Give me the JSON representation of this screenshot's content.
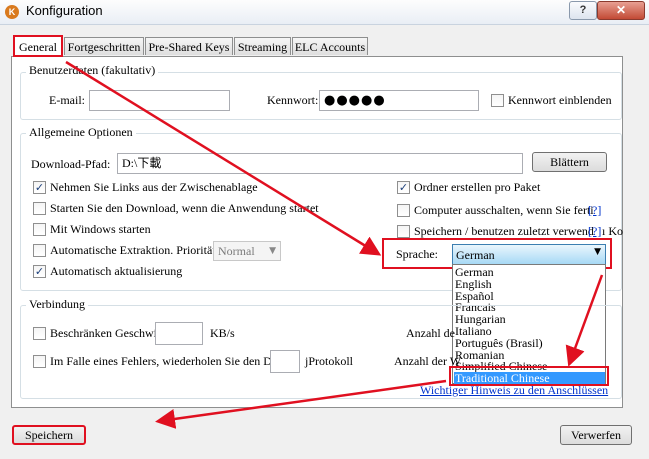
{
  "window": {
    "title": "Konfiguration",
    "icon_letter": "K",
    "help_label": "?",
    "close_label": "✕"
  },
  "tabs": [
    "General",
    "Fortgeschritten",
    "Pre-Shared Keys",
    "Streaming",
    "ELC Accounts"
  ],
  "user_data": {
    "legend": "Benutzerdaten (fakultativ)",
    "email_label": "E-mail:",
    "email_value": "",
    "password_label": "Kennwort:",
    "password_value": "●●●●●",
    "show_password_label": "Kennwort einblenden"
  },
  "general": {
    "legend": "Allgemeine Optionen",
    "download_path_label": "Download-Pfad:",
    "download_path_value": "D:\\下載",
    "browse_label": "Blättern",
    "options_left": [
      {
        "label": "Nehmen Sie Links aus der Zwischenablage",
        "checked": true
      },
      {
        "label": "Starten Sie den Download, wenn die Anwendung startet",
        "checked": false
      },
      {
        "label": "Mit Windows starten",
        "checked": false
      },
      {
        "label": "Automatische Extraktion. Priorität:",
        "checked": false
      },
      {
        "label": "Automatisch aktualisierung",
        "checked": true
      }
    ],
    "priority_value": "Normal",
    "options_right": [
      {
        "label": "Ordner erstellen pro Paket",
        "checked": true
      },
      {
        "label": "Computer ausschalten, wenn Sie ferti",
        "checked": false
      },
      {
        "label": "Speichern / benutzen zuletzt verwend",
        "checked": false
      }
    ],
    "help_link": "[?]",
    "help_tail": "ı Ko",
    "language_label": "Sprache:",
    "language_selected": "German",
    "language_options": [
      "German",
      "English",
      "Español",
      "Francais",
      "Hungarian",
      "Italiano",
      "Português (Brasil)",
      "Romanian",
      "Simplified Chinese",
      "Traditional Chinese"
    ],
    "language_highlighted": "Traditional Chinese"
  },
  "connection": {
    "legend": "Verbindung",
    "limit_label": "Beschränken Geschwir",
    "limit_unit": "KB/s",
    "retry_label": "Im Falle eines Fehlers, wiederholen Sie den Dov",
    "retry_tail": "jProtokoll",
    "count_label_1": "Anzahl de",
    "count_label_2": "Anzahl der W",
    "notice_link": "Wichtiger Hinweis zu den Anschlüssen"
  },
  "footer": {
    "save_label": "Speichern",
    "discard_label": "Verwerfen"
  },
  "colors": {
    "highlight": "#e01020",
    "selection": "#3399ff",
    "link": "#0033cc"
  }
}
